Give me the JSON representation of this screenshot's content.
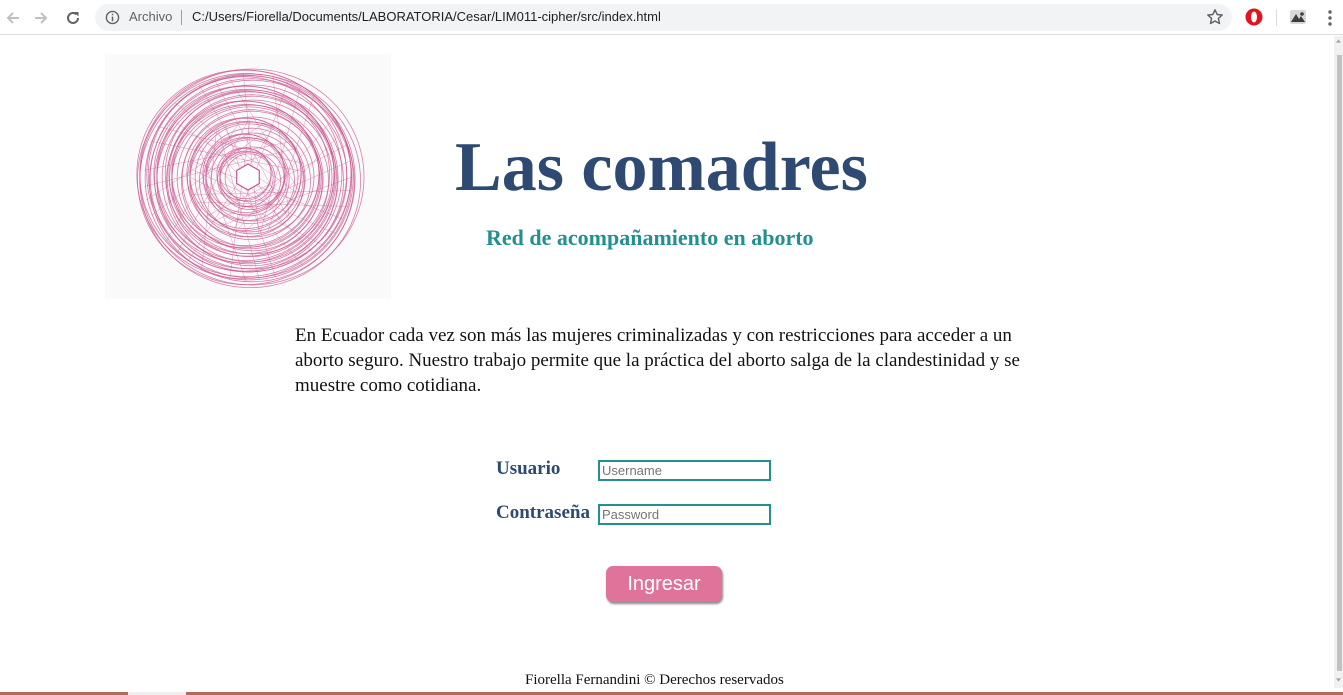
{
  "browser": {
    "security_label": "Archivo",
    "url": "C:/Users/Fiorella/Documents/LABORATORIA/Cesar/LIM011-cipher/src/index.html"
  },
  "header": {
    "title": "Las comadres",
    "subtitle": "Red de acompañamiento en aborto"
  },
  "intro": {
    "text": "En Ecuador cada vez son más las mujeres criminalizadas y con restricciones para acceder a un aborto seguro. Nuestro trabajo permite que la práctica del aborto salga de la clandestinidad y se muestre como cotidiana."
  },
  "login": {
    "username_label": "Usuario",
    "username_placeholder": "Username",
    "password_label": "Contraseña",
    "password_placeholder": "Password",
    "submit_label": "Ingresar"
  },
  "footer": {
    "text": "Fiorella Fernandini © Derechos reservados"
  },
  "colors": {
    "title": "#2e4a73",
    "subtitle": "#23908f",
    "button": "#e0739a",
    "logo_stroke": "#c8558f"
  }
}
